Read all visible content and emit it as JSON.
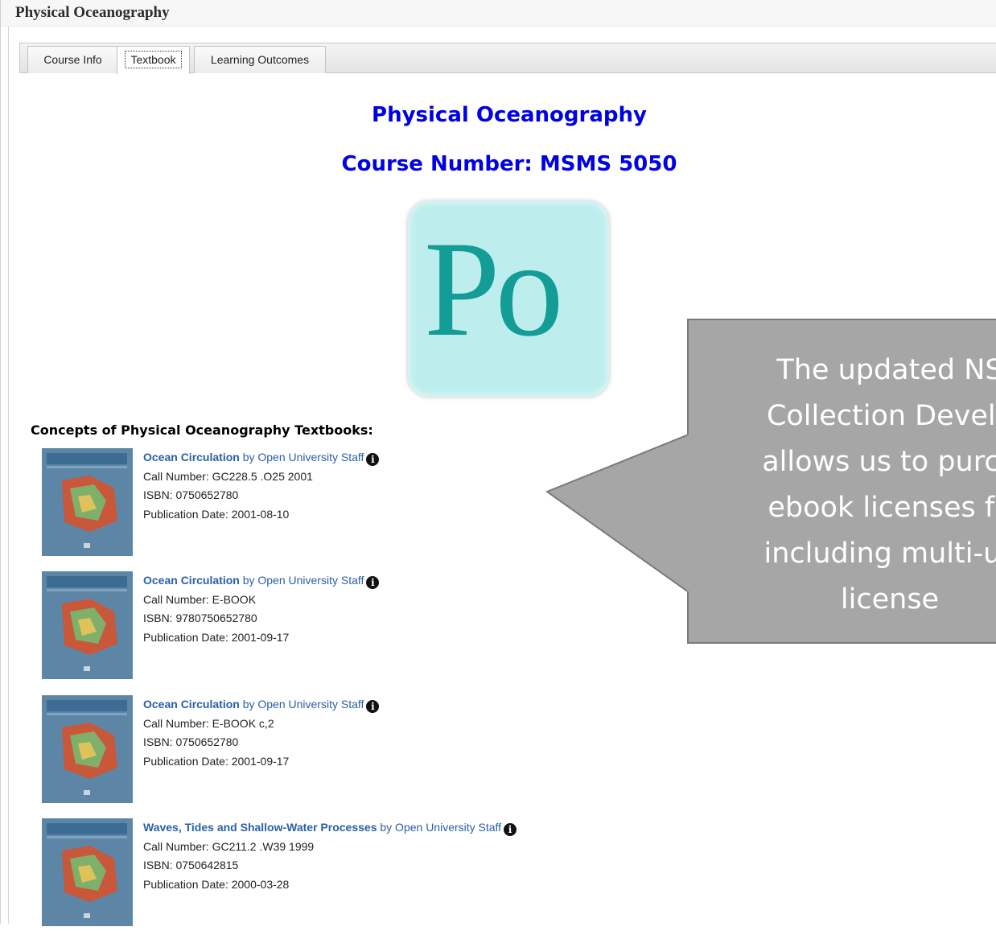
{
  "header": {
    "title": "Physical Oceanography"
  },
  "tabs": [
    {
      "label": "Course Info"
    },
    {
      "label": "Textbook"
    },
    {
      "label": "Learning Outcomes"
    }
  ],
  "course": {
    "title": "Physical Oceanography",
    "number": "Course Number: MSMS 5050",
    "logo_text": "Po"
  },
  "section_heading": "Concepts of Physical Oceanography Textbooks:",
  "books": [
    {
      "title": "Ocean Circulation",
      "by": "by Open University Staff",
      "call_number": "Call Number: GC228.5 .O25 2001",
      "isbn": "ISBN: 0750652780",
      "pub_date": "Publication Date: 2001-08-10"
    },
    {
      "title": "Ocean Circulation",
      "by": "by Open University Staff",
      "call_number": "Call Number: E-BOOK",
      "isbn": "ISBN: 9780750652780",
      "pub_date": "Publication Date: 2001-09-17"
    },
    {
      "title": "Ocean Circulation",
      "by": "by Open University Staff",
      "call_number": "Call Number: E-BOOK c,2",
      "isbn": "ISBN: 0750652780",
      "pub_date": "Publication Date: 2001-09-17"
    },
    {
      "title": "Waves, Tides and Shallow-Water Processes",
      "by": "by Open University Staff",
      "call_number": "Call Number: GC211.2 .W39 1999",
      "isbn": "ISBN: 0750642815",
      "pub_date": "Publication Date: 2000-03-28"
    }
  ],
  "callout": {
    "text": "The updated NS\nCollection Develo\nallows us to purch\nebook licenses fo\nincluding multi-us\nlicense"
  },
  "colors": {
    "heading_blue": "#0000e6",
    "link_blue": "#2a5fa8",
    "logo_bg": "#bdeeed",
    "logo_text": "#149c96",
    "callout_bg": "#a6a6a6"
  },
  "icons": {
    "info": "info-circle-icon"
  }
}
